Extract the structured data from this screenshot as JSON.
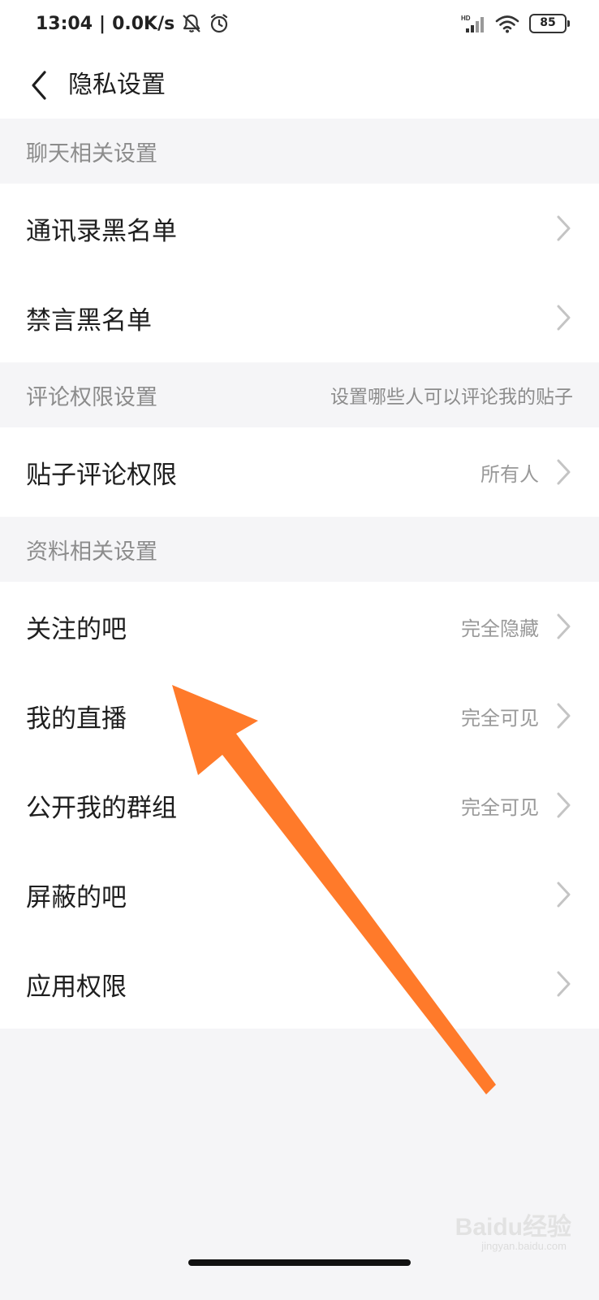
{
  "status_bar": {
    "time": "13:04",
    "network_speed": "0.0K/s",
    "battery": "85",
    "icons": [
      "bell-off-icon",
      "alarm-icon",
      "hd-signal-icon",
      "wifi-icon",
      "battery-icon"
    ]
  },
  "nav": {
    "back_icon": "chevron-left-icon",
    "title": "隐私设置"
  },
  "sections": [
    {
      "title": "聊天相关设置",
      "items": [
        {
          "label": "通讯录黑名单",
          "value": ""
        },
        {
          "label": "禁言黑名单",
          "value": ""
        }
      ]
    },
    {
      "title": "评论权限设置",
      "description": "设置哪些人可以评论我的贴子",
      "items": [
        {
          "label": "贴子评论权限",
          "value": "所有人"
        }
      ]
    },
    {
      "title": "资料相关设置",
      "items": [
        {
          "label": "关注的吧",
          "value": "完全隐藏"
        },
        {
          "label": "我的直播",
          "value": "完全可见"
        },
        {
          "label": "公开我的群组",
          "value": "完全可见"
        },
        {
          "label": "屏蔽的吧",
          "value": ""
        },
        {
          "label": "应用权限",
          "value": ""
        }
      ]
    }
  ],
  "annotation": {
    "type": "arrow",
    "color": "#ff7a2a",
    "points_to": "关注的吧"
  },
  "watermark": {
    "text": "Baidu经验",
    "sub": "jingyan.baidu.com"
  }
}
